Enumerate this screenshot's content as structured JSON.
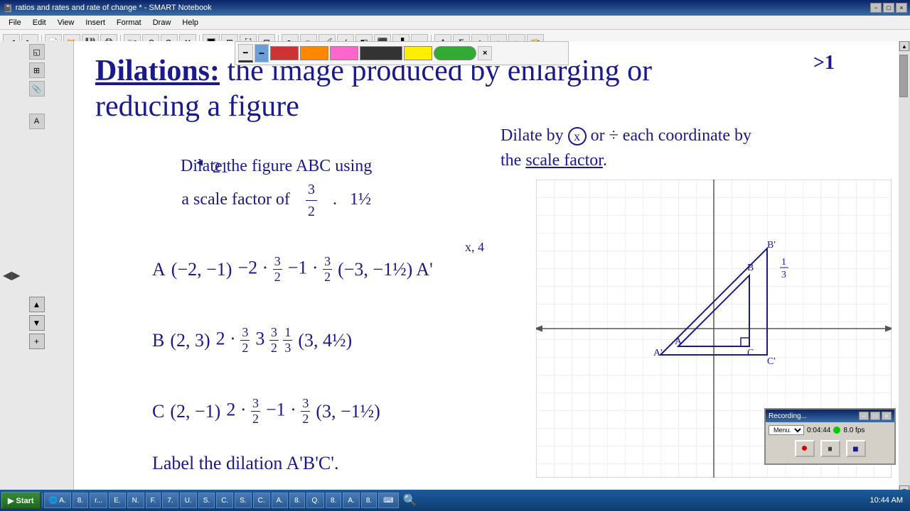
{
  "titlebar": {
    "title": "ratios and rates and rate of change * - SMART Notebook",
    "icon": "📓",
    "controls": [
      "−",
      "□",
      "×"
    ]
  },
  "menubar": {
    "items": [
      "File",
      "Edit",
      "View",
      "Insert",
      "Format",
      "Draw",
      "Help"
    ]
  },
  "content": {
    "title_underlined": "Dilations:",
    "title_rest": "  the image produced by enlarging or",
    "title2": "reducing a figure",
    "dilate_rule": "Dilate by × or ÷ each coordinate by",
    "dilate_rule2": "the scale factor.",
    "problem": "Dilate the figure ABC using\na scale factor of",
    "fraction": {
      "num": "3",
      "den": "2"
    },
    "also": ". 1½",
    "point_A": "A  (−2, −1)",
    "point_B": "B  (2, 3)",
    "point_C": "C  (2, −1)",
    "label_instruction": "Label the dilation A'B'C'.",
    "math_A": "−2 · 3/2    −1 · 3/2    (−3, −1½)  A'",
    "math_B": "2 · 3/2    3 · 3/2 = (3, 4½)  B'",
    "math_C": "2 · 3/2    −1 · 3/2    (3, −1½)  C'",
    "x_label": "x, 4",
    "gt1": ">1"
  },
  "recording": {
    "title": "Recording...",
    "menu_label": "Menu...",
    "timer": "0:04:44",
    "fps": "8.0 fps",
    "dot_color": "#00cc00",
    "controls": [
      "●",
      "⏸",
      "■"
    ]
  },
  "taskbar": {
    "start": "Start",
    "time": "10:44 AM",
    "items": [
      "A.",
      "8.",
      "r...",
      "E.",
      "N.",
      "F.",
      "7.",
      "U.",
      "S.",
      "C.",
      "S.",
      "C.",
      "A.",
      "8.",
      "Q.",
      "8.",
      "A.",
      "8.",
      "keyboard"
    ]
  }
}
